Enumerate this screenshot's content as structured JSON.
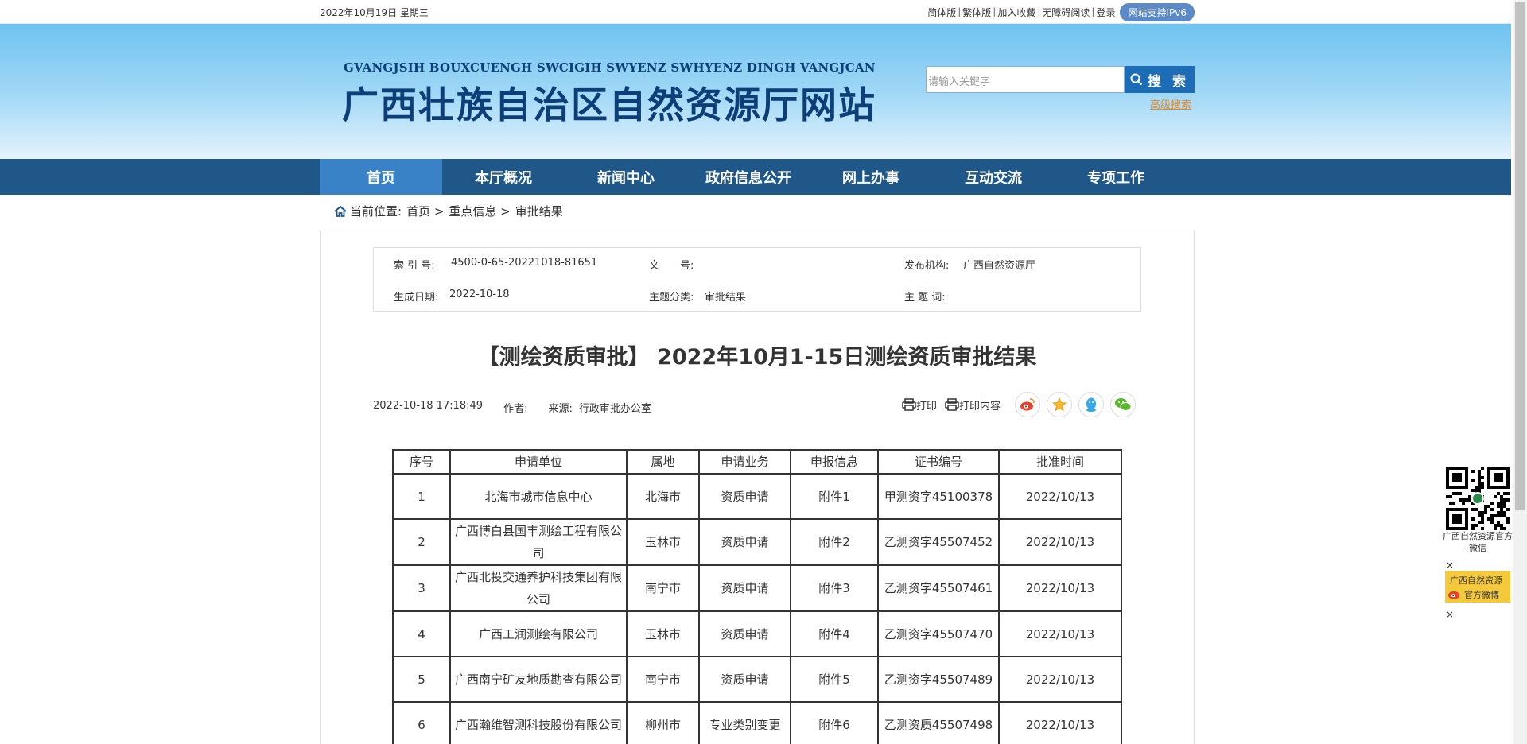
{
  "topbar": {
    "date": "2022年10月19日 星期三",
    "links": [
      "简体版",
      "繁体版",
      "加入收藏",
      "无障碍阅读",
      "登录"
    ],
    "ipv6": "网站支持IPv6"
  },
  "banner": {
    "subtitle": "GVANGJSIH BOUXCUENGH SWCIGIH SWYENZ SWHYENZ DINGH VANGJCAN",
    "title": "广西壮族自治区自然资源厅网站"
  },
  "search": {
    "placeholder": "请输入关键字",
    "button": "搜 索",
    "advanced": "高级搜索"
  },
  "nav": {
    "items": [
      "首页",
      "本厅概况",
      "新闻中心",
      "政府信息公开",
      "网上办事",
      "互动交流",
      "专项工作"
    ]
  },
  "breadcrumb": {
    "label": "当前位置:",
    "items": [
      "首页 >",
      "重点信息 >",
      "审批结果"
    ]
  },
  "meta": {
    "index_label": "索 引 号:",
    "index_value": "4500-0-65-20221018-81651",
    "doc_label": "文　　号:",
    "doc_value": "",
    "org_label": "发布机构:",
    "org_value": "广西自然资源厅",
    "date_label": "生成日期:",
    "date_value": "2022-10-18",
    "topic_label": "主题分类:",
    "topic_value": "审批结果",
    "keyword_label": "主 题 词:",
    "keyword_value": ""
  },
  "article": {
    "title": "【测绘资质审批】 2022年10月1-15日测绘资质审批结果",
    "datetime": "2022-10-18 17:18:49",
    "author_label": "作者:",
    "source_label": "来源:",
    "source_value": "行政审批办公室",
    "print": "打印",
    "print_content": "打印内容"
  },
  "table": {
    "headers": [
      "序号",
      "申请单位",
      "属地",
      "申请业务",
      "申报信息",
      "证书编号",
      "批准时间"
    ],
    "rows": [
      {
        "no": "1",
        "unit": "北海市城市信息中心",
        "region": "北海市",
        "business": "资质申请",
        "info": "附件1",
        "cert": "甲测资字45100378",
        "date": "2022/10/13"
      },
      {
        "no": "2",
        "unit": "广西博白县国丰测绘工程有限公司",
        "region": "玉林市",
        "business": "资质申请",
        "info": "附件2",
        "cert": "乙测资字45507452",
        "date": "2022/10/13"
      },
      {
        "no": "3",
        "unit": "广西北投交通养护科技集团有限公司",
        "region": "南宁市",
        "business": "资质申请",
        "info": "附件3",
        "cert": "乙测资字45507461",
        "date": "2022/10/13"
      },
      {
        "no": "4",
        "unit": "广西工润测绘有限公司",
        "region": "玉林市",
        "business": "资质申请",
        "info": "附件4",
        "cert": "乙测资字45507470",
        "date": "2022/10/13"
      },
      {
        "no": "5",
        "unit": "广西南宁矿友地质勘查有限公司",
        "region": "南宁市",
        "business": "资质申请",
        "info": "附件5",
        "cert": "乙测资字45507489",
        "date": "2022/10/13"
      },
      {
        "no": "6",
        "unit": "广西瀚维智测科技股份有限公司",
        "region": "柳州市",
        "business": "专业类别变更",
        "info": "附件6",
        "cert": "乙测资质45507498",
        "date": "2022/10/13"
      }
    ]
  },
  "floats": {
    "wechat_label": "广西自然资源官方微信",
    "weibo_line1": "广西自然资源",
    "weibo_line2": "官方微博",
    "close": "×"
  },
  "colors": {
    "nav_bg": "#1e5788",
    "nav_active": "#3a82c7",
    "title_blue": "#0c3f77",
    "search_btn": "#1d6db6",
    "advanced_link": "#e08a2f"
  }
}
